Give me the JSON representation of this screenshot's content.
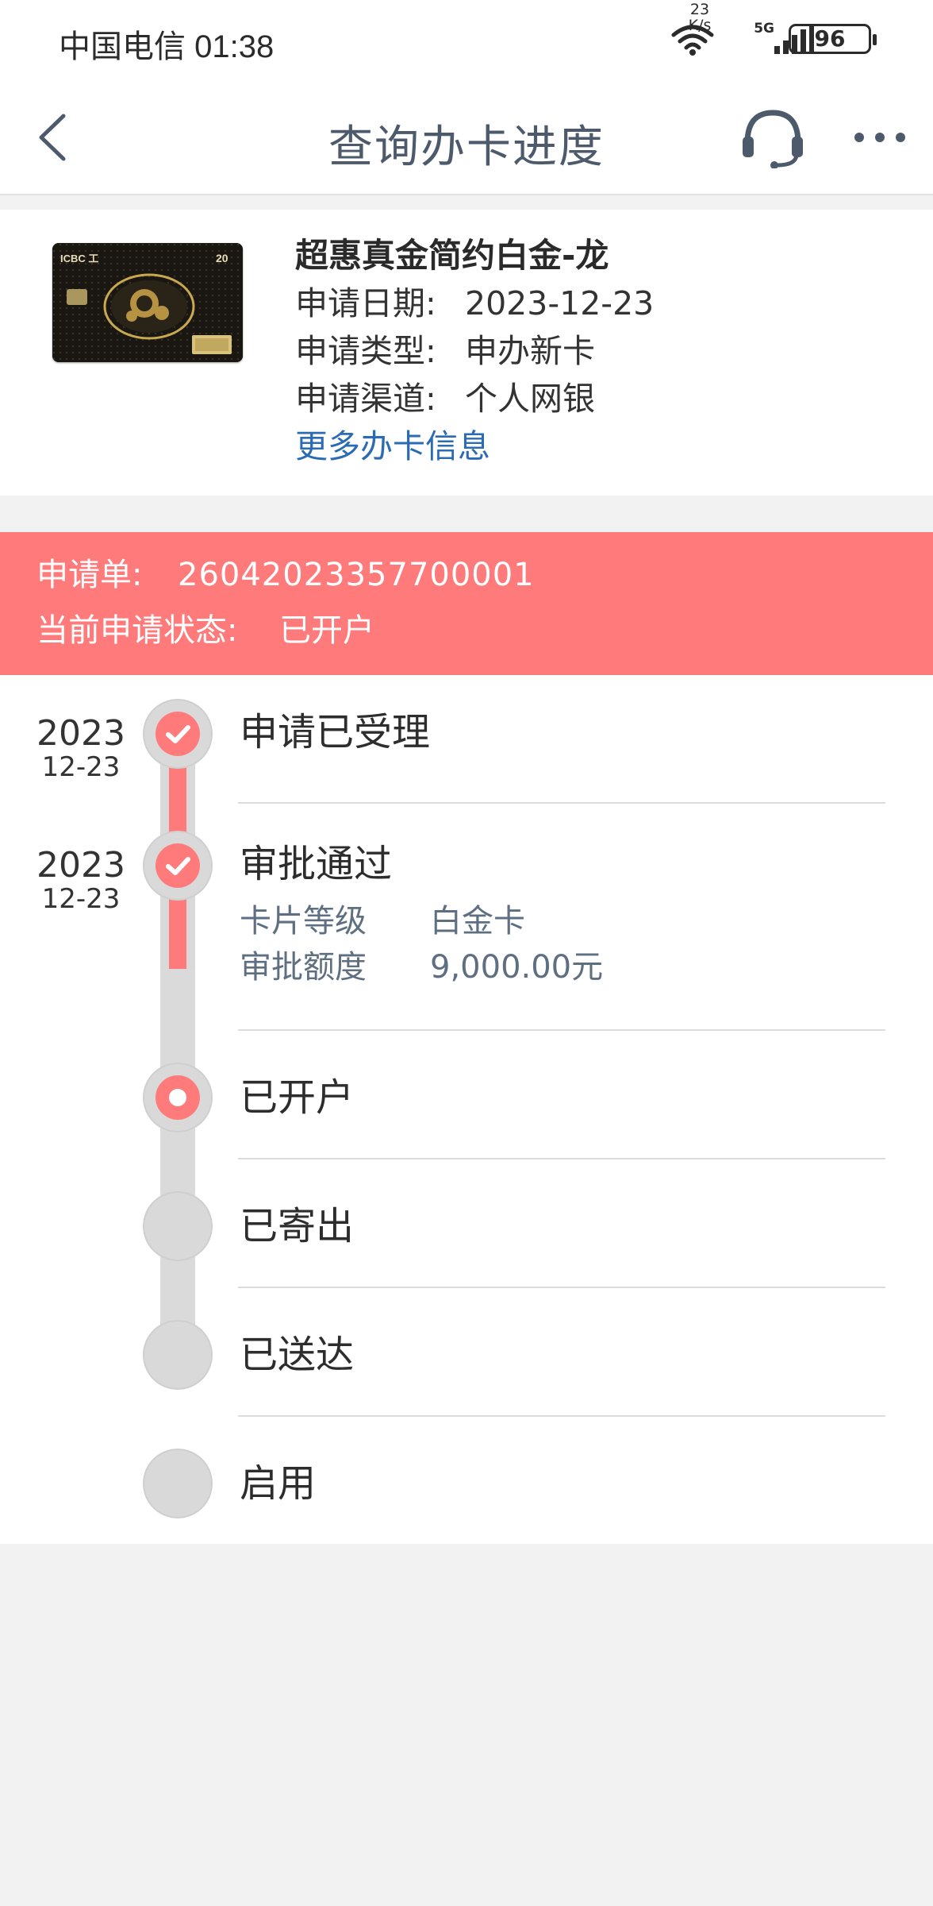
{
  "status_bar": {
    "carrier": "中国电信",
    "time": "01:38",
    "net_speed_value": "23",
    "net_speed_unit": "K/s",
    "network": "5G",
    "battery": "96"
  },
  "nav": {
    "title": "查询办卡进度"
  },
  "card": {
    "name": "超惠真金简约白金-龙",
    "apply_date_label": "申请日期:",
    "apply_date": "2023-12-23",
    "apply_type_label": "申请类型:",
    "apply_type": "申办新卡",
    "apply_channel_label": "申请渠道:",
    "apply_channel": "个人网银",
    "more_link": "更多办卡信息",
    "image_text": {
      "bank": "ICBC 工",
      "badge": "20"
    }
  },
  "banner": {
    "order_label": "申请单:",
    "order_no": "26042023357700001",
    "status_label": "当前申请状态:",
    "status": "已开户"
  },
  "timeline": {
    "steps": [
      {
        "title": "申请已受理",
        "year": "2023",
        "date": "12-23",
        "state": "done"
      },
      {
        "title": "审批通过",
        "year": "2023",
        "date": "12-23",
        "state": "done",
        "details": [
          {
            "label": "卡片等级",
            "value": "白金卡"
          },
          {
            "label": "审批额度",
            "value": "9,000.00元"
          }
        ]
      },
      {
        "title": "已开户",
        "state": "current"
      },
      {
        "title": "已寄出",
        "state": "pending"
      },
      {
        "title": "已送达",
        "state": "pending"
      },
      {
        "title": "启用",
        "state": "pending"
      }
    ]
  },
  "colors": {
    "accent": "#ff7b7b",
    "link": "#2a6bb4",
    "title": "#4d5a6b",
    "detail": "#5f6f82",
    "pending": "#d9d9d9"
  },
  "icons": [
    "back-chevron-icon",
    "headset-icon",
    "more-dots-icon",
    "wifi-icon",
    "signal-icon",
    "check-icon"
  ]
}
